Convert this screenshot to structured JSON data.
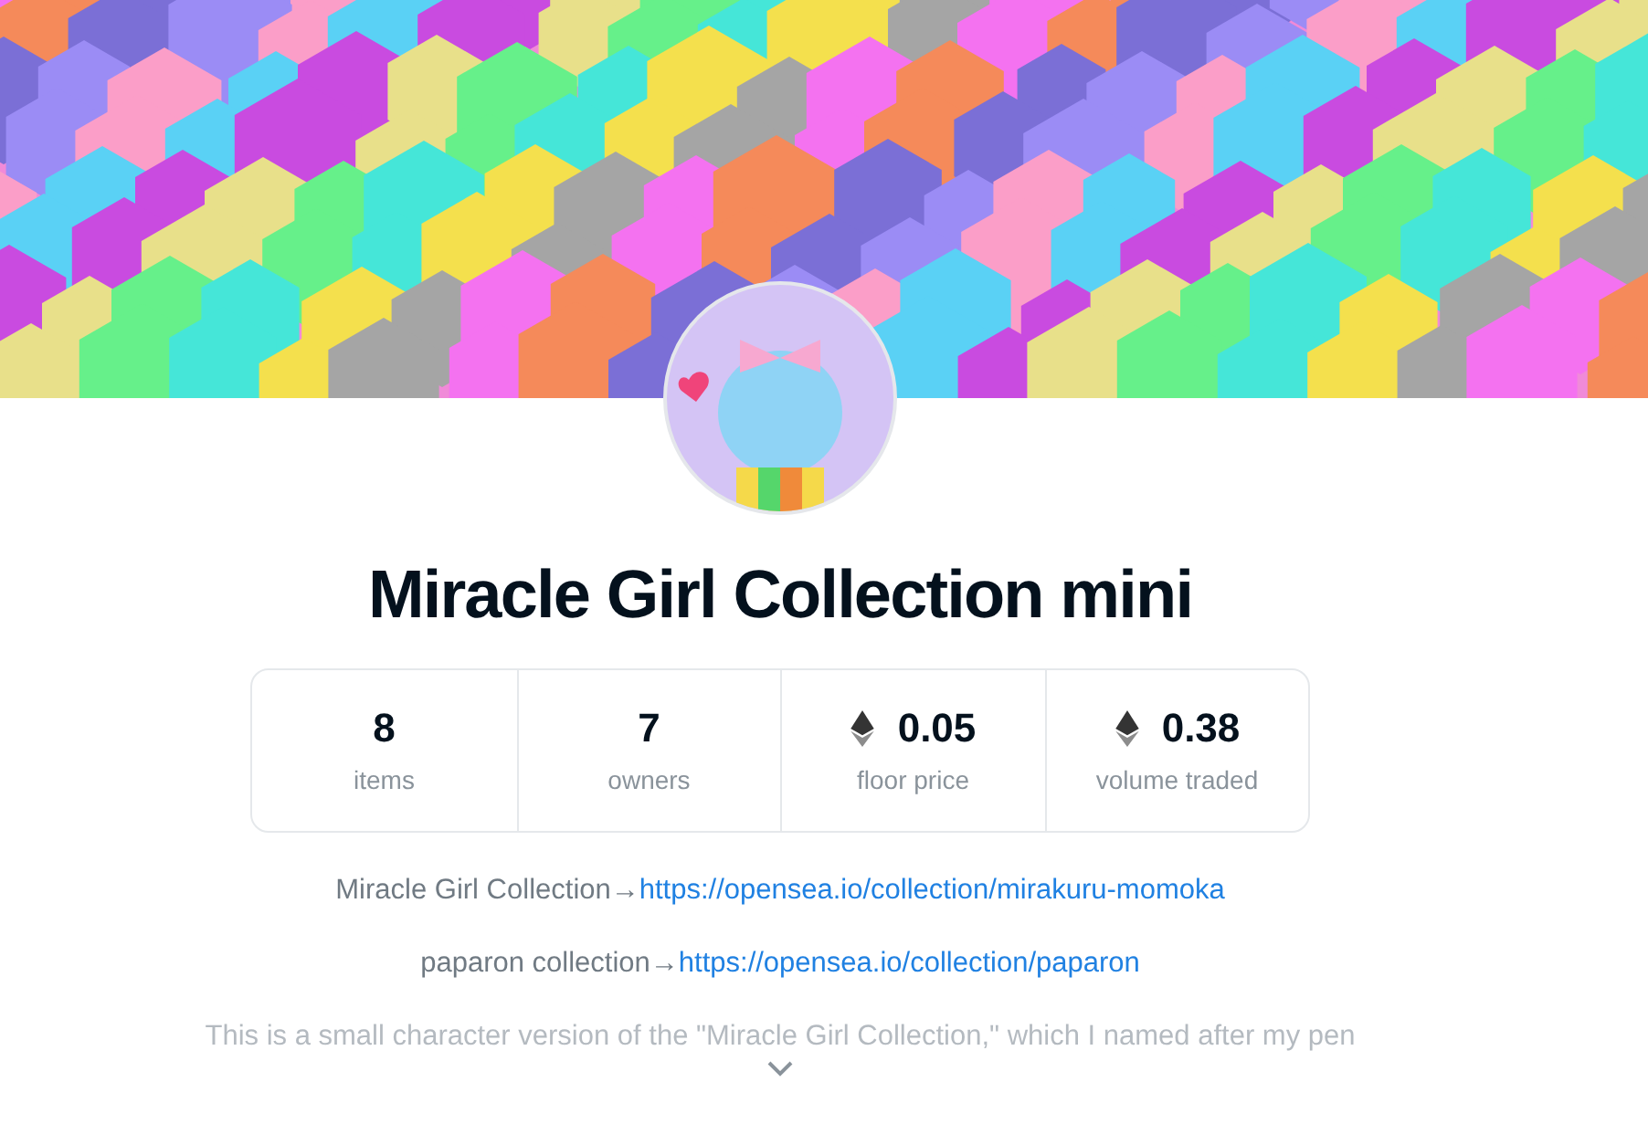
{
  "collection": {
    "title": "Miracle Girl Collection mini"
  },
  "stats": [
    {
      "value": "8",
      "label": "items",
      "kind": "count"
    },
    {
      "value": "7",
      "label": "owners",
      "kind": "count"
    },
    {
      "value": "0.05",
      "label": "floor price",
      "kind": "eth"
    },
    {
      "value": "0.38",
      "label": "volume traded",
      "kind": "eth"
    }
  ],
  "description": [
    {
      "text": "Miracle Girl Collection→",
      "link": "https://opensea.io/collection/mirakuru-momoka"
    },
    {
      "text": "paparon collection→",
      "link": "https://opensea.io/collection/paparon"
    }
  ],
  "faded_text": "This is a small character version of the \"Miracle Girl Collection,\" which I named after my pen"
}
